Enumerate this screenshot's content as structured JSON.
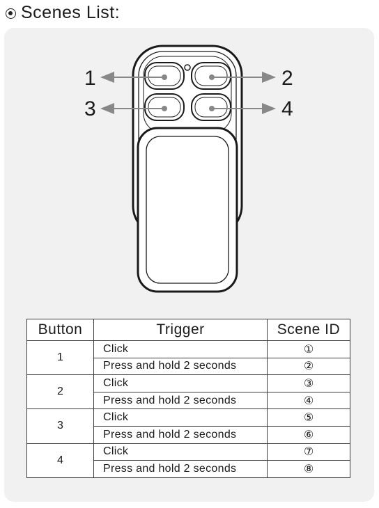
{
  "header": {
    "title": "Scenes List:"
  },
  "remote": {
    "button_numbers": [
      "1",
      "2",
      "3",
      "4"
    ]
  },
  "table": {
    "columns": [
      "Button",
      "Trigger",
      "Scene ID"
    ],
    "groups": [
      {
        "button": "1",
        "rows": [
          {
            "trigger": "Click",
            "scene_id": "①"
          },
          {
            "trigger": "Press and hold 2 seconds",
            "scene_id": "②"
          }
        ]
      },
      {
        "button": "2",
        "rows": [
          {
            "trigger": "Click",
            "scene_id": "③"
          },
          {
            "trigger": "Press and hold 2 seconds",
            "scene_id": "④"
          }
        ]
      },
      {
        "button": "3",
        "rows": [
          {
            "trigger": "Click",
            "scene_id": "⑤"
          },
          {
            "trigger": "Press and hold 2 seconds",
            "scene_id": "⑥"
          }
        ]
      },
      {
        "button": "4",
        "rows": [
          {
            "trigger": "Click",
            "scene_id": "⑦"
          },
          {
            "trigger": "Press and hold 2 seconds",
            "scene_id": "⑧"
          }
        ]
      }
    ]
  }
}
